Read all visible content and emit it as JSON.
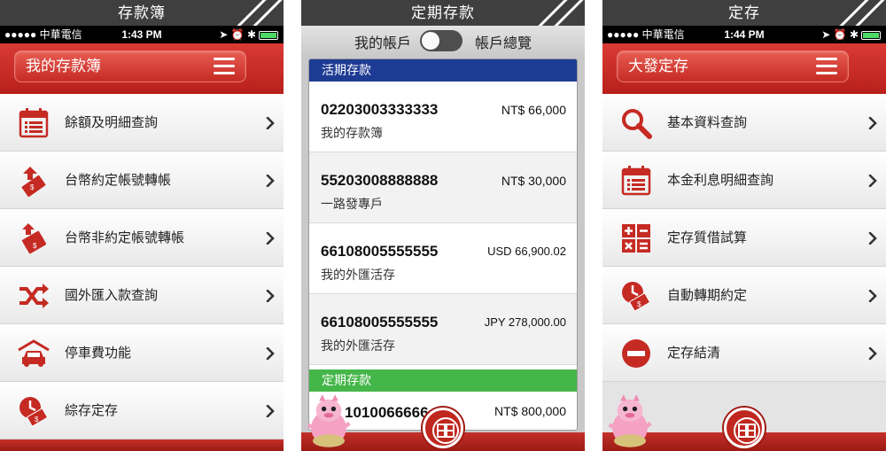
{
  "status": {
    "carrier": "●●●●● 中華電信"
  },
  "screen1": {
    "title": "存款簿",
    "time": "1:43 PM",
    "header_label": "我的存款簿",
    "menu": [
      {
        "label": "餘額及明細查詢",
        "icon": "calendar-list-icon"
      },
      {
        "label": "台幣約定帳號轉帳",
        "icon": "money-transfer-icon"
      },
      {
        "label": "台幣非約定帳號轉帳",
        "icon": "money-stack-transfer-icon"
      },
      {
        "label": "國外匯入款查詢",
        "icon": "shuffle-arrows-icon"
      },
      {
        "label": "停車費功能",
        "icon": "car-garage-icon"
      },
      {
        "label": "綜存定存",
        "icon": "clock-money-icon"
      }
    ]
  },
  "screen2": {
    "title": "定期存款",
    "toggle": {
      "left_label": "我的帳戶",
      "right_label": "帳戶總覽"
    },
    "sections": {
      "demand": "活期存款",
      "fixed": "定期存款"
    },
    "accounts": [
      {
        "number": "02203003333333",
        "amount": "NT$ 66,000",
        "name": "我的存款簿"
      },
      {
        "number": "55203008888888",
        "amount": "NT$ 30,000",
        "name": "一路發專戶"
      },
      {
        "number": "66108005555555",
        "amount": "USD 66,900.02",
        "name": "我的外匯活存"
      },
      {
        "number": "66108005555555",
        "amount": "JPY 278,000.00",
        "name": "我的外匯活存"
      }
    ],
    "partial_account": {
      "number": "1010066666",
      "amount": "NT$ 800,000"
    }
  },
  "screen3": {
    "title": "定存",
    "time": "1:44 PM",
    "header_label": "大發定存",
    "menu": [
      {
        "label": "基本資料查詢",
        "icon": "search-icon"
      },
      {
        "label": "本金利息明細查詢",
        "icon": "calendar-list-icon"
      },
      {
        "label": "定存質借試算",
        "icon": "calculator-icon"
      },
      {
        "label": "自動轉期約定",
        "icon": "clock-money-icon"
      },
      {
        "label": "定存結清",
        "icon": "minus-circle-icon"
      }
    ]
  },
  "colors": {
    "brand_red": "#c52a23",
    "demand_header": "#1e3b94",
    "fixed_header": "#45b649"
  }
}
